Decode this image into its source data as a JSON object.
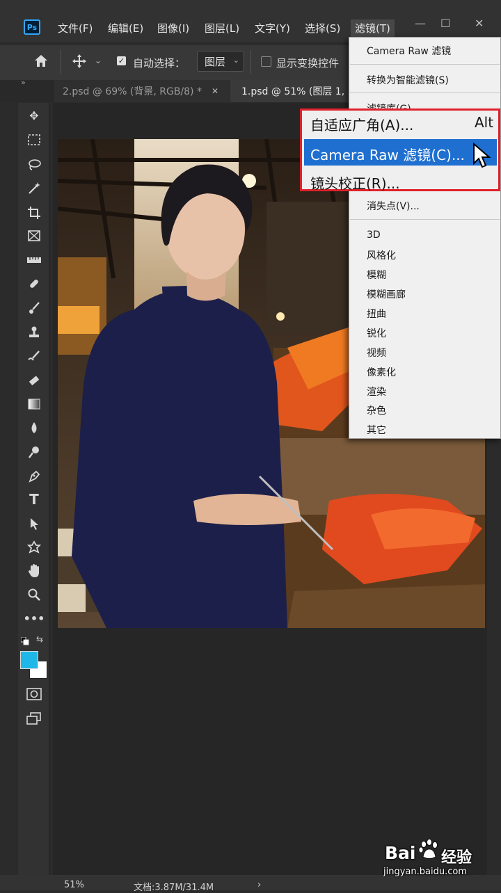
{
  "app": {
    "logo": "Ps"
  },
  "menubar": {
    "items": [
      {
        "label": "文件(F)"
      },
      {
        "label": "编辑(E)"
      },
      {
        "label": "图像(I)"
      },
      {
        "label": "图层(L)"
      },
      {
        "label": "文字(Y)"
      },
      {
        "label": "选择(S)"
      },
      {
        "label": "滤镜(T)"
      }
    ],
    "window_controls": {
      "minimize": "—",
      "maximize": "☐",
      "close": "✕"
    }
  },
  "options": {
    "auto_select_label": "自动选择：",
    "auto_select_checked": true,
    "layer_dropdown_value": "图层",
    "show_transform_label": "显示变换控件",
    "show_transform_checked": false
  },
  "tabs": [
    {
      "label": "2.psd @ 69% (背景, RGB/8) *",
      "close": "✕"
    },
    {
      "label": "1.psd @ 51% (图层 1,",
      "close": ""
    }
  ],
  "tabbar": {
    "collapse": "»"
  },
  "filter_menu": {
    "last_filter": "Camera Raw 滤镜",
    "convert_smart": "转换为智能滤镜(S)",
    "gallery": "滤镜库(G)...",
    "vanishing_point": "消失点(V)...",
    "groups": [
      "3D",
      "风格化",
      "模糊",
      "模糊画廊",
      "扭曲",
      "锐化",
      "视频",
      "像素化",
      "渲染",
      "杂色",
      "其它"
    ]
  },
  "callout": {
    "items": [
      {
        "label": "自适应广角(A)...",
        "shortcut": "Alt"
      },
      {
        "label": "Camera Raw 滤镜(C)...",
        "shortcut": ""
      },
      {
        "label": "镜头校正(R)...",
        "shortcut": ""
      }
    ],
    "highlighted_index": 1
  },
  "status": {
    "zoom": "51%",
    "doc": "文档:3.87M/31.4M",
    "arrow": "›"
  },
  "watermark": {
    "brand": "Bai",
    "brand2": "经验",
    "url": "jingyan.baidu.com"
  },
  "colors": {
    "foreground": "#1fb7e8",
    "background": "#ffffff",
    "highlight": "#1e6fd0",
    "callout_border": "#e0202a"
  }
}
